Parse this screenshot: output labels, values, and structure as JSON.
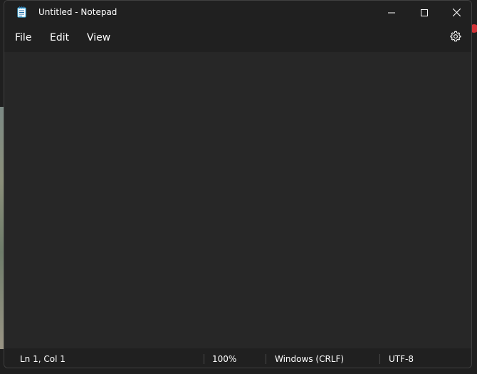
{
  "window": {
    "title": "Untitled - Notepad"
  },
  "menu": {
    "file": "File",
    "edit": "Edit",
    "view": "View"
  },
  "editor": {
    "content": ""
  },
  "status": {
    "position": "Ln 1, Col 1",
    "zoom": "100%",
    "line_ending": "Windows (CRLF)",
    "encoding": "UTF-8"
  },
  "icons": {
    "app": "notepad-icon",
    "minimize": "minimize-icon",
    "maximize": "maximize-icon",
    "close": "close-icon",
    "settings": "gear-icon"
  },
  "colors": {
    "accent": "#4cc2ff",
    "titlebar": "#202020",
    "editor_bg": "#272727",
    "text": "#ffffff",
    "desktop_badge": "#d13438"
  }
}
